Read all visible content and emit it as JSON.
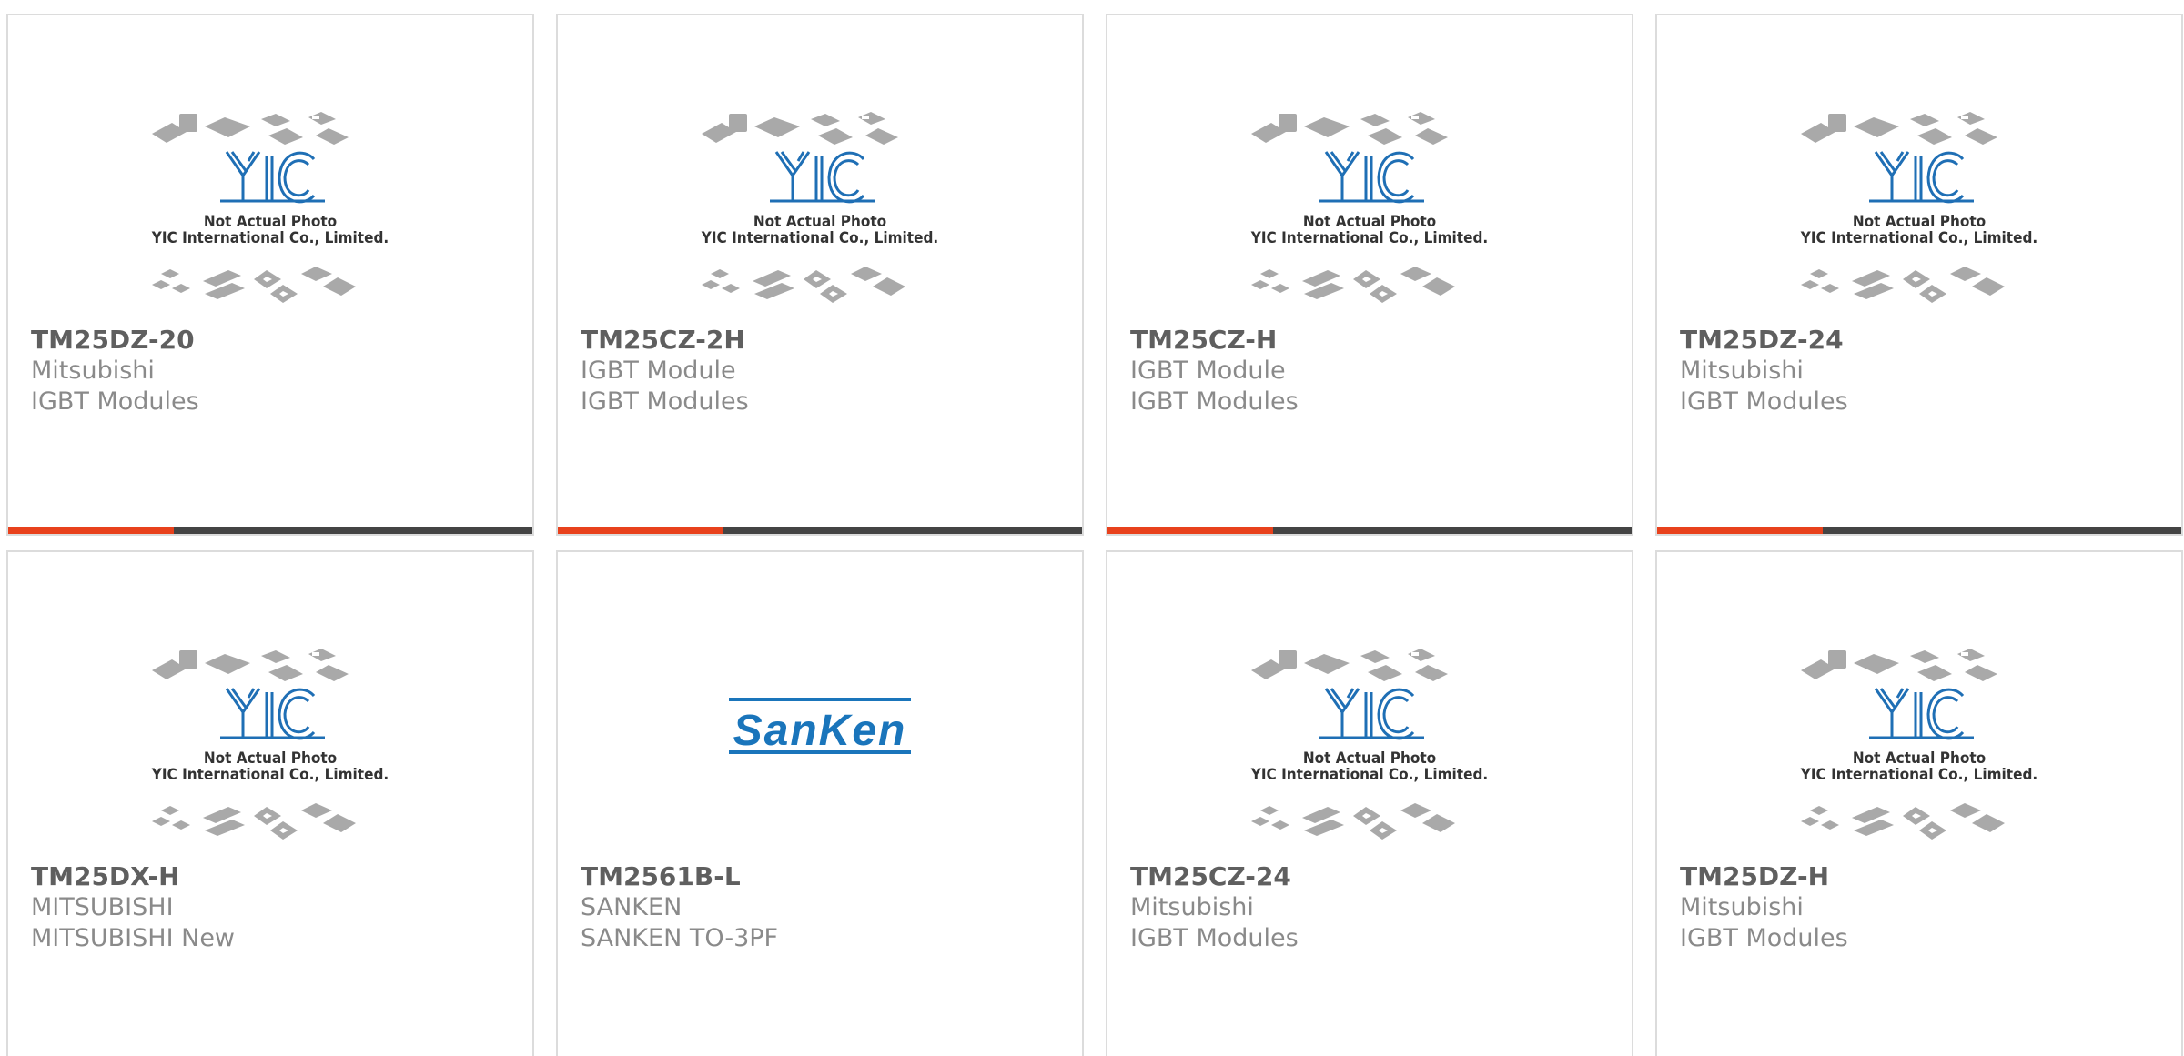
{
  "colors": {
    "accent": "#e8411c",
    "bar_dark": "#444444",
    "yic_blue": "#1f6fb5",
    "sanken_blue": "#1a75bb"
  },
  "placeholder": {
    "line1": "Not Actual Photo",
    "line2": "YIC International Co., Limited."
  },
  "logos": {
    "yic": "YIC",
    "sanken": "SanKen"
  },
  "products": [
    {
      "part": "TM25DZ-20",
      "maker": "Mitsubishi",
      "category": "IGBT Modules",
      "image": "yic-placeholder"
    },
    {
      "part": "TM25CZ-2H",
      "maker": "IGBT Module",
      "category": "IGBT Modules",
      "image": "yic-placeholder"
    },
    {
      "part": "TM25CZ-H",
      "maker": "IGBT Module",
      "category": "IGBT Modules",
      "image": "yic-placeholder"
    },
    {
      "part": "TM25DZ-24",
      "maker": "Mitsubishi",
      "category": "IGBT Modules",
      "image": "yic-placeholder"
    },
    {
      "part": "TM25DX-H",
      "maker": "MITSUBISHI",
      "category": "MITSUBISHI New",
      "image": "yic-placeholder"
    },
    {
      "part": "TM2561B-L",
      "maker": "SANKEN",
      "category": "SANKEN TO-3PF",
      "image": "sanken-logo"
    },
    {
      "part": "TM25CZ-24",
      "maker": "Mitsubishi",
      "category": "IGBT Modules",
      "image": "yic-placeholder"
    },
    {
      "part": "TM25DZ-H",
      "maker": "Mitsubishi",
      "category": "IGBT Modules",
      "image": "yic-placeholder"
    }
  ]
}
